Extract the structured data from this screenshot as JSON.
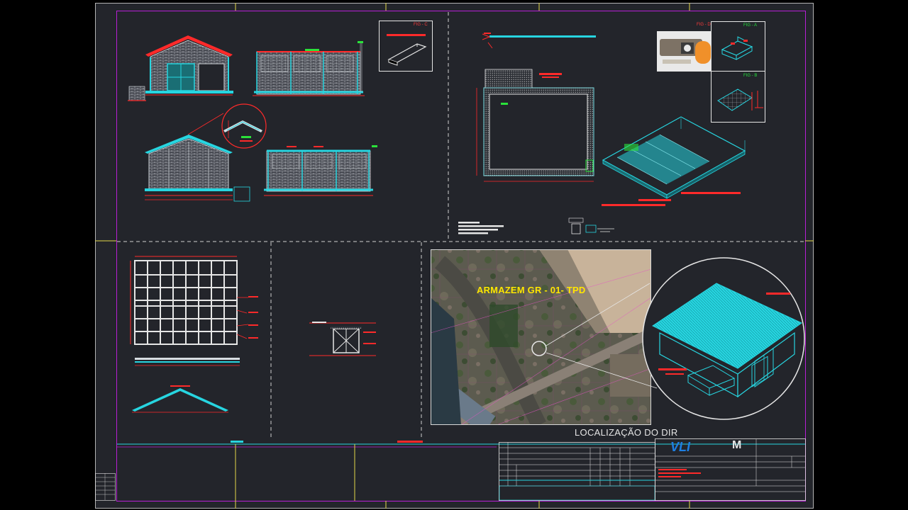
{
  "drawing": {
    "location_label": "ARMAZEM GR - 01- TPD",
    "location_caption": "LOCALIZAÇÃO DO DIR",
    "figure_labels": {
      "fig_c": "FIG - C",
      "fig_d": "FIG - D",
      "fig_a": "FIG - A",
      "fig_b": "FIG - B"
    }
  },
  "title_block": {
    "brand": "VLI",
    "brand_mark": "M"
  },
  "colors": {
    "background": "#23252b",
    "frame": "#b4b4b4",
    "border": "#b81fd6",
    "cyan": "#27d5e0",
    "red": "#ff2a2a",
    "green": "#2ae23a",
    "yellow": "#ffe600",
    "blue": "#1d7fe3",
    "white": "#e6e6e6"
  }
}
